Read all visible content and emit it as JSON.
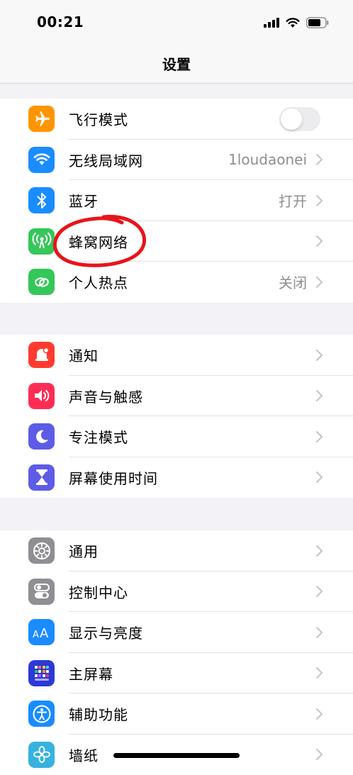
{
  "status_bar": {
    "time": "00:21"
  },
  "nav": {
    "title": "设置"
  },
  "groups": [
    [
      {
        "label": "飞行模式",
        "icon": "airplane-icon",
        "color": "#ff9500",
        "toggle": "off"
      },
      {
        "label": "无线局域网",
        "icon": "wifi-icon",
        "color": "#1a8cff",
        "value": "1loudaonei"
      },
      {
        "label": "蓝牙",
        "icon": "bluetooth-icon",
        "color": "#1a8cff",
        "value": "打开"
      },
      {
        "label": "蜂窝网络",
        "icon": "antenna-icon",
        "color": "#34c759"
      },
      {
        "label": "个人热点",
        "icon": "link-icon",
        "color": "#34c759",
        "value": "关闭"
      }
    ],
    [
      {
        "label": "通知",
        "icon": "bell-icon",
        "color": "#ff3b30"
      },
      {
        "label": "声音与触感",
        "icon": "speaker-icon",
        "color": "#ff2d55"
      },
      {
        "label": "专注模式",
        "icon": "moon-icon",
        "color": "#5e5ce6"
      },
      {
        "label": "屏幕使用时间",
        "icon": "hourglass-icon",
        "color": "#5e5ce6"
      }
    ],
    [
      {
        "label": "通用",
        "icon": "gear-icon",
        "color": "#8e8e93"
      },
      {
        "label": "控制中心",
        "icon": "switches-icon",
        "color": "#8e8e93"
      },
      {
        "label": "显示与亮度",
        "icon": "text-size-icon",
        "color": "#1a8cff"
      },
      {
        "label": "主屏幕",
        "icon": "grid-icon",
        "color": "#2c39d6"
      },
      {
        "label": "辅助功能",
        "icon": "accessibility-icon",
        "color": "#1a8cff"
      },
      {
        "label": "墙纸",
        "icon": "flower-icon",
        "color": "#36b2e0"
      }
    ]
  ],
  "annotation": {
    "color": "#e8141b",
    "target": "蜂窝网络"
  }
}
